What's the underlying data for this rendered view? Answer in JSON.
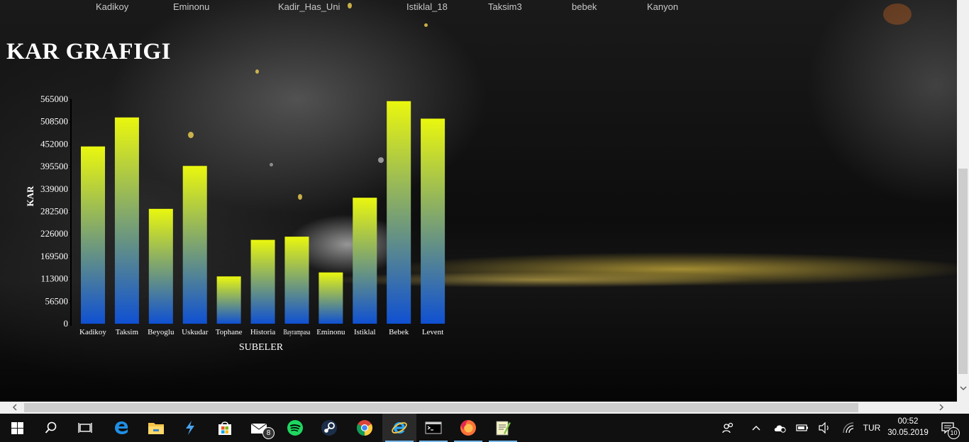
{
  "tabs": [
    "Kadikoy",
    "Eminonu",
    "Kadir_Has_Uni",
    "Istiklal_18",
    "Taksim3",
    "bebek",
    "Kanyon"
  ],
  "page_title": "KAR GRAFIGI",
  "chart_data": {
    "type": "bar",
    "title": "KAR GRAFIGI",
    "xlabel": "SUBELER",
    "ylabel": "KAR",
    "categories": [
      "Kadikoy",
      "Taksim",
      "Beyoglu",
      "Uskudar",
      "Tophane",
      "Historia",
      "Bayrampasa",
      "Eminonu",
      "Istiklal",
      "Bebek",
      "Levent"
    ],
    "values": [
      446000,
      519000,
      289000,
      397000,
      119000,
      211000,
      219000,
      129000,
      317000,
      560000,
      516000
    ],
    "yticks": [
      "0",
      "56500",
      "113000",
      "169500",
      "226000",
      "282500",
      "339000",
      "395500",
      "452000",
      "508500",
      "565000"
    ],
    "ylim": [
      0,
      565000
    ],
    "grid": false,
    "legend": "none",
    "bar_gradient": [
      "#0f50d2",
      "#eaf70e"
    ]
  },
  "scrollbars": {
    "left_arrow": "<",
    "right_arrow": ">",
    "down_arrow": "v"
  },
  "taskbar": {
    "apps": [
      "start-icon",
      "search-icon",
      "task-view-icon",
      "edge-icon",
      "file-explorer-icon",
      "visual-studio-icon",
      "store-icon",
      "mail-icon",
      "spotify-icon",
      "steam-icon",
      "chrome-icon",
      "internet-explorer-icon",
      "terminal-icon",
      "firefox-icon",
      "notepad-icon"
    ],
    "mail_badge": "8",
    "language": "TUR",
    "time": "00:52",
    "date": "30.05.2019",
    "notification_badge": "10"
  }
}
